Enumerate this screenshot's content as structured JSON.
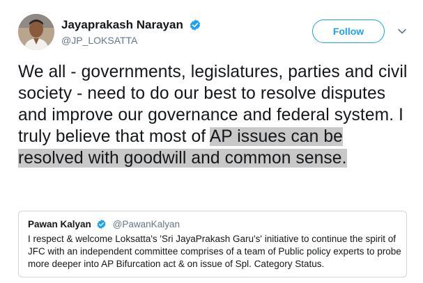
{
  "author": {
    "display_name": "Jayaprakash Narayan",
    "handle": "@JP_LOKSATTA",
    "verified": true
  },
  "actions": {
    "follow_label": "Follow",
    "menu_icon": "chevron-down-icon"
  },
  "tweet": {
    "text_before_highlight": "We all - governments, legislatures, parties and civil society - need to do our best to resolve disputes and improve our governance and federal system. I truly believe that most of ",
    "text_highlighted": "AP issues can be resolved with goodwill and common sense."
  },
  "quoted_tweet": {
    "display_name": "Pawan Kalyan",
    "handle": "@PawanKalyan",
    "verified": true,
    "text": "I respect & welcome Loksatta's 'Sri JayaPrakash Garu's' initiative to continue the spirit of JFC with an independent committee comprises of a team of Public policy experts to probe more deeper into AP Bifurcation act & on issue of Spl. Category Status."
  },
  "colors": {
    "accent": "#1da1f2",
    "secondary_text": "#657786",
    "highlight": "#c8c8c8",
    "border": "#ccd6dd"
  }
}
